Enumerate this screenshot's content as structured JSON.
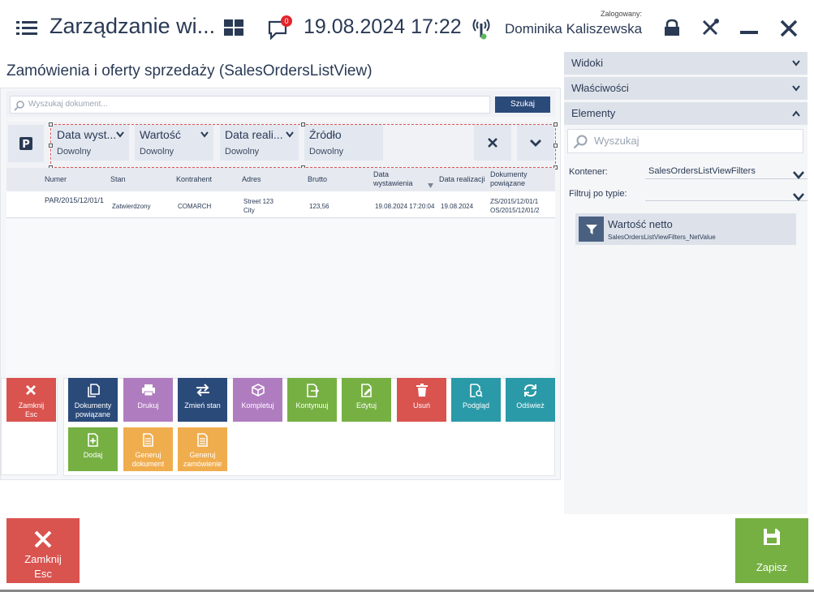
{
  "header": {
    "title": "Zarządzanie wi...",
    "datetime": "19.08.2024 17:22",
    "notifications_count": "0",
    "logged_label": "Zalogowany:",
    "user_name": "Dominika Kaliszewska"
  },
  "view": {
    "title": "Zamówienia i oferty sprzedaży (SalesOrdersListView)"
  },
  "search": {
    "placeholder": "Wyszukaj dokument...",
    "button_label": "Szukaj"
  },
  "filters": [
    {
      "label": "Data wyst...",
      "value": "Dowolny"
    },
    {
      "label": "Wartość",
      "value": "Dowolny"
    },
    {
      "label": "Data reali...",
      "value": "Dowolny"
    },
    {
      "label": "Źródło",
      "value": "Dowolny"
    }
  ],
  "grid": {
    "columns": [
      "Numer",
      "Stan",
      "Kontrahent",
      "Adres",
      "Brutto",
      "Data wystawienia",
      "Data realizacji",
      "Dokumenty powiązane"
    ],
    "rows": [
      {
        "numer": "PAR/2015/12/01/1",
        "stan": "Zatwierdzony",
        "kontrahent": "COMARCH",
        "adres_line1": "Street 123",
        "adres_line2": "City",
        "brutto": "123,56",
        "data_wystawienia": "19.08.2024 17:20:04",
        "data_realizacji": "19.08.2024",
        "dok_line1": "ZS/2015/12/01/1",
        "dok_line2": "OS/2015/12/01/2"
      }
    ]
  },
  "inner_close": {
    "label": "Zamknij",
    "shortcut": "Esc"
  },
  "actions": [
    {
      "label": "Dokumenty powiązane",
      "color": "#2a4a7a"
    },
    {
      "label": "Drukuj",
      "color": "#b07cc0"
    },
    {
      "label": "Zmień stan",
      "color": "#2a4a7a"
    },
    {
      "label": "Kompletuj",
      "color": "#b07cc0"
    },
    {
      "label": "Kontynuuj",
      "color": "#76b043"
    },
    {
      "label": "Edytuj",
      "color": "#76b043"
    },
    {
      "label": "Usuń",
      "color": "#d9534f"
    },
    {
      "label": "Podgląd",
      "color": "#2a9aa8"
    },
    {
      "label": "Odśwież",
      "color": "#2a9aa8"
    },
    {
      "label": "Dodaj",
      "color": "#76b043"
    },
    {
      "label": "Generuj dokument",
      "color": "#f0ad4e"
    },
    {
      "label": "Generuj zamówienie",
      "color": "#f0ad4e"
    }
  ],
  "side_panel": {
    "sections": [
      "Widoki",
      "Właściwości",
      "Elementy"
    ],
    "search_placeholder": "Wyszukaj",
    "container_label": "Kontener:",
    "container_value": "SalesOrdersListViewFilters",
    "filter_type_label": "Filtruj po typie:",
    "filter_type_value": "",
    "element": {
      "name": "Wartość netto",
      "path": "SalesOrdersListViewFilters_NetValue"
    }
  },
  "bottom": {
    "close_label": "Zamknij",
    "close_shortcut": "Esc",
    "save_label": "Zapisz"
  }
}
